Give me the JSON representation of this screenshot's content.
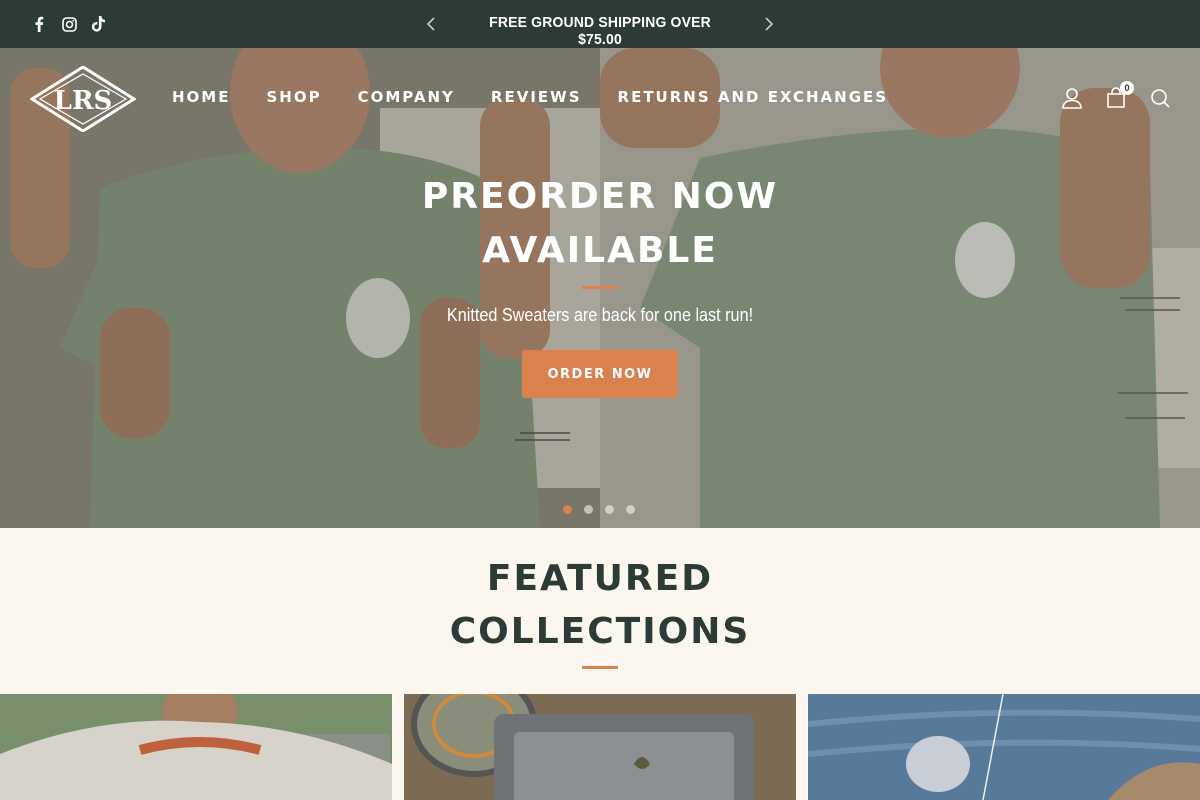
{
  "announcement": {
    "text": "FREE GROUND SHIPPING OVER $75.00",
    "prev_icon": "chevron-left-icon",
    "next_icon": "chevron-right-icon"
  },
  "social": [
    "facebook-icon",
    "instagram-icon",
    "tiktok-icon"
  ],
  "logo": {
    "text": "LRS"
  },
  "nav": {
    "items": [
      {
        "label": "HOME"
      },
      {
        "label": "SHOP"
      },
      {
        "label": "COMPANY"
      },
      {
        "label": "REVIEWS"
      },
      {
        "label": "RETURNS AND EXCHANGES"
      }
    ]
  },
  "header_icons": {
    "account": "user-icon",
    "cart": "cart-icon",
    "cart_count": "0",
    "search": "search-icon"
  },
  "hero": {
    "title_line1": "PREORDER NOW",
    "title_line2": "AVAILABLE",
    "subtitle": "Knitted Sweaters are back for one last run!",
    "button": "ORDER NOW",
    "slide_count": 4,
    "active_slide": 1
  },
  "featured": {
    "title_line1": "FEATURED",
    "title_line2": "COLLECTIONS"
  },
  "colors": {
    "topbar": "#2c3b35",
    "accent": "#d9824f",
    "page_bg": "#fbf7ef"
  }
}
